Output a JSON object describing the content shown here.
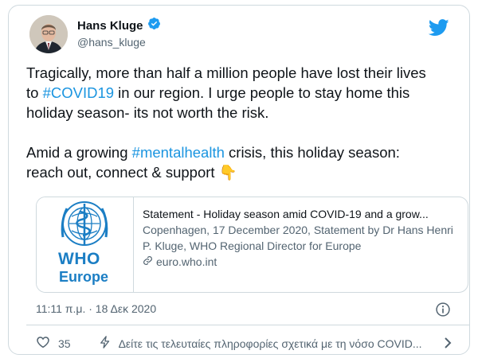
{
  "author": {
    "name": "Hans Kluge",
    "handle": "@hans_kluge",
    "verified": true
  },
  "tweet": {
    "line1_a": "Tragically, more than half a million people have lost their lives",
    "line2_a": "to ",
    "hashtag1": "#COVID19",
    "line2_b": " in our region. I urge people to stay home this",
    "line3": "holiday season- its not worth the risk.",
    "line5_a": "Amid a growing ",
    "hashtag2": "#mentalhealth",
    "line5_b": " crisis, this holiday season:",
    "line6": "reach out, connect & support ",
    "emoji": "👇"
  },
  "link_card": {
    "logo_text1": "WHO",
    "logo_text2": "Europe",
    "title": "Statement - Holiday season amid COVID-19 and a grow...",
    "desc": "Copenhagen, 17 December 2020, Statement by Dr Hans Henri P. Kluge, WHO Regional Director for Europe",
    "domain": "euro.who.int"
  },
  "timestamp": "11:11 π.μ. · 18 Δεκ 2020",
  "actions": {
    "like_count": "35",
    "covid_info": "Δείτε τις τελευταίες πληροφορίες σχετικά με τη νόσο COVID..."
  },
  "colors": {
    "accent": "#1b95e0",
    "who_blue": "#1b7ec4",
    "muted": "#536471",
    "border": "#cfd9de"
  },
  "icons": [
    "verified-badge-icon",
    "twitter-bird-icon",
    "link-icon",
    "info-icon",
    "heart-icon",
    "lightning-icon",
    "chevron-right-icon"
  ]
}
